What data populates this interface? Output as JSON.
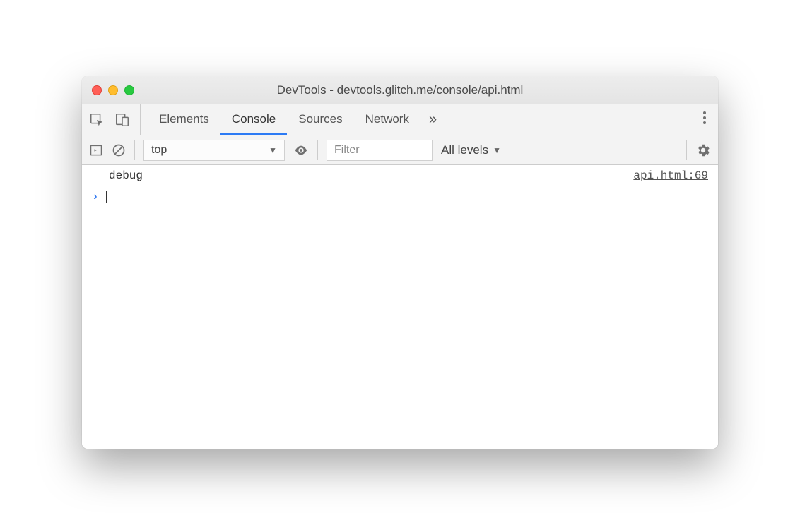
{
  "window": {
    "title": "DevTools - devtools.glitch.me/console/api.html"
  },
  "tabs": {
    "items": [
      {
        "label": "Elements",
        "active": false
      },
      {
        "label": "Console",
        "active": true
      },
      {
        "label": "Sources",
        "active": false
      },
      {
        "label": "Network",
        "active": false
      }
    ],
    "more_glyph": "»"
  },
  "toolbar": {
    "context": "top",
    "filter_placeholder": "Filter",
    "levels_label": "All levels"
  },
  "console": {
    "logs": [
      {
        "message": "debug",
        "source": "api.html:69"
      }
    ],
    "prompt_glyph": "›"
  }
}
